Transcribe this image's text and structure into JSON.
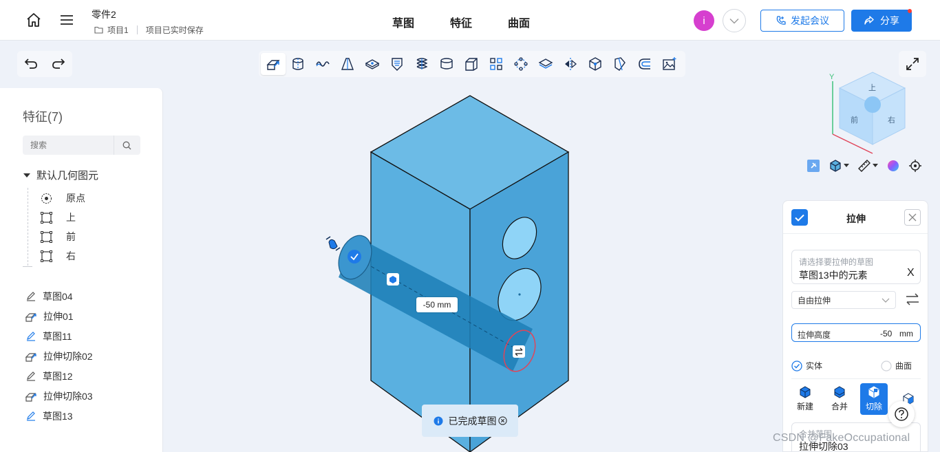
{
  "header": {
    "doc_title": "零件2",
    "project": "项目1",
    "save_status": "项目已实时保存",
    "tabs": [
      "草图",
      "特征",
      "曲面"
    ],
    "avatar_letter": "i",
    "meeting_label": "发起会议",
    "share_label": "分享"
  },
  "left_panel": {
    "title": "特征(7)",
    "search_placeholder": "搜索",
    "tree_group": "默认几何图元",
    "tree_items": [
      "原点",
      "上",
      "前",
      "右"
    ],
    "features": [
      "草图04",
      "拉伸01",
      "草图11",
      "拉伸切除02",
      "草图12",
      "拉伸切除03",
      "草图13"
    ]
  },
  "viewport": {
    "dimension_label": "-50 mm",
    "toast": "已完成草图",
    "axis_y": "Y",
    "cube_top": "上",
    "cube_front": "前",
    "cube_right": "右"
  },
  "extrude_panel": {
    "title": "拉伸",
    "sketch_placeholder": "请选择要拉伸的草图",
    "sketch_value": "草图13中的元素",
    "clear_symbol": "X",
    "mode": "自由拉伸",
    "height_label": "拉伸高度",
    "height_value": "-50",
    "height_unit": "mm",
    "body_solid": "实体",
    "body_surface": "曲面",
    "ops": [
      "新建",
      "合并",
      "切除"
    ],
    "merge_placeholder": "合并范围",
    "merge_value": "拉伸切除03"
  },
  "watermark": "CSDN @FakeOccupational",
  "colors": {
    "accent": "#1e7ae8",
    "model": "#5ab0e0",
    "model_side": "#4aa3d8",
    "cylinder": "#1f7fb7",
    "avatar": "#d63fcf"
  }
}
